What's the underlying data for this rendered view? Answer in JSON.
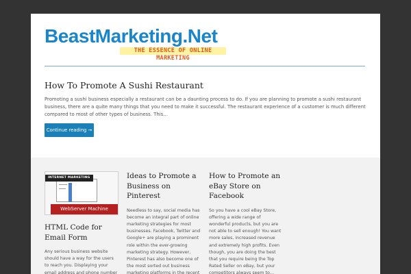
{
  "site": {
    "name": "BeastMarketing.Net",
    "tagline": "THE ESSENCE OF ONLINE MARKETING"
  },
  "featured": {
    "title": "How To Promote A Sushi Restaurant",
    "excerpt": "Promoting a sushi business especially a restaurant can be a daunting process to do. If you are planning to promote a sushi restaurant business, there are a quite many things that you need to make it successful. The restaurant experience of a customer is much different compared to most of other types of business. This…",
    "read_more": "Continue reading →"
  },
  "posts": [
    {
      "category": "INTERNET MARKETING",
      "thumbnail_label": "WebServer Machine",
      "title": "HTML Code for Email Form",
      "excerpt": "Any serious business website should have a way for the users to reach you. Displaying your email address and phone number is one"
    },
    {
      "title": "Ideas to Promote a Business on Pinterest",
      "excerpt": "Needless to say, social media has become an integral part of online marketing strategies for most businesses. Facebook, Twitter and Google+ are playing a prominent role within the ever-growing marketing strategy. However, Pinterest has also become one of the most sorted out business marketing platforms in the recent times. It is a unique, image-based"
    },
    {
      "title": "How to Promote an eBay Store on Facebook",
      "excerpt": "So you have a cool eBay Store, offering a wide range of wonderful products, but you are not able to sell enough! You want more sales, increased revenue and extremely high profits. Even though, you are doing the best that you require being the Top Rated Seller on eBay, but your competitors always seem to…"
    }
  ],
  "colors": {
    "background": "#333333",
    "accent": "#1b7fb8",
    "logo": "#1a85c8",
    "tagline": "#e05a12"
  }
}
